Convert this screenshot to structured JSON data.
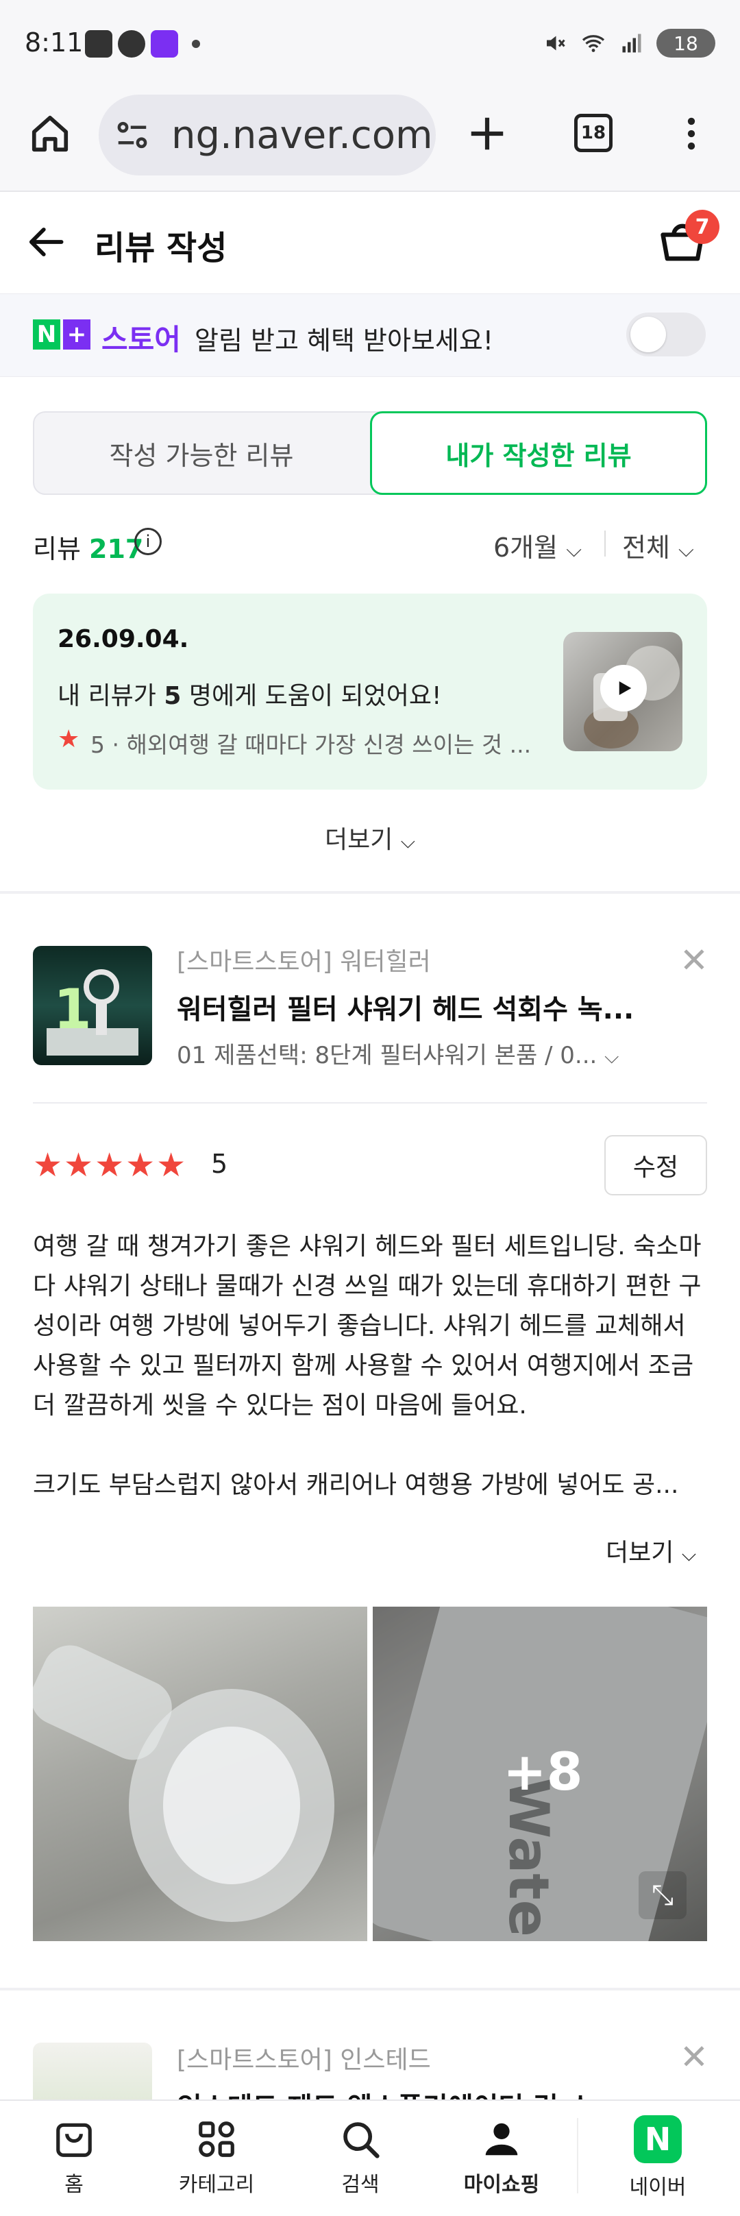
{
  "status_bar": {
    "time": "8:11",
    "battery": "18"
  },
  "browser": {
    "url": "ng.naver.com",
    "tab_count": "18"
  },
  "header": {
    "title": "리뷰 작성",
    "cart_count": "7"
  },
  "promo": {
    "store_label": "스토어",
    "message": "알림 받고 혜택 받아보세요!"
  },
  "tabs": {
    "available": "작성 가능한 리뷰",
    "written": "내가 작성한 리뷰"
  },
  "review_summary": {
    "label": "리뷰",
    "count": "217",
    "period_filter": "6개월",
    "type_filter": "전체"
  },
  "highlight_card": {
    "date": "26.09.04.",
    "message_prefix": "내 리뷰가 ",
    "helpful_count": "5",
    "message_suffix": " 명에게 도움이 되었어요!",
    "rating": "5",
    "snippet": "해외여행 갈 때마다 가장 신경 쓰이는 것 ..."
  },
  "more_label": "더보기",
  "review_item": {
    "store": "[스마트스토어] 워터힐러",
    "product_name": "워터힐러 필터 샤워기 헤드 석회수 녹...",
    "option": "01 제품선택: 8단계 필터샤워기 본품 / 0...",
    "rating": "5",
    "edit_label": "수정",
    "text": "여행 갈 때 챙겨가기 좋은 샤워기 헤드와 필터 세트입니당. 숙소마다 샤워기 상태나 물때가 신경 쓰일 때가 있는데 휴대하기 편한 구성이라 여행 가방에 넣어두기 좋습니다. 샤워기 헤드를 교체해서 사용할 수 있고 필터까지 함께 사용할 수 있어서 여행지에서 조금 더 깔끔하게 씻을 수 있다는 점이 마음에 들어요.\n\n크기도 부담스럽지 않아서 캐리어나 여행용 가방에 넣어도 공...",
    "more_label": "더보기",
    "extra_photos": "+8"
  },
  "next_item": {
    "store": "[스마트스토어] 인스테드",
    "product_name": "인스테드 제트 엑스폴리에이터 린 스"
  },
  "bottom_nav": {
    "home": "홈",
    "category": "카테고리",
    "search": "검색",
    "my_shopping": "마이쇼핑",
    "naver": "네이버"
  }
}
